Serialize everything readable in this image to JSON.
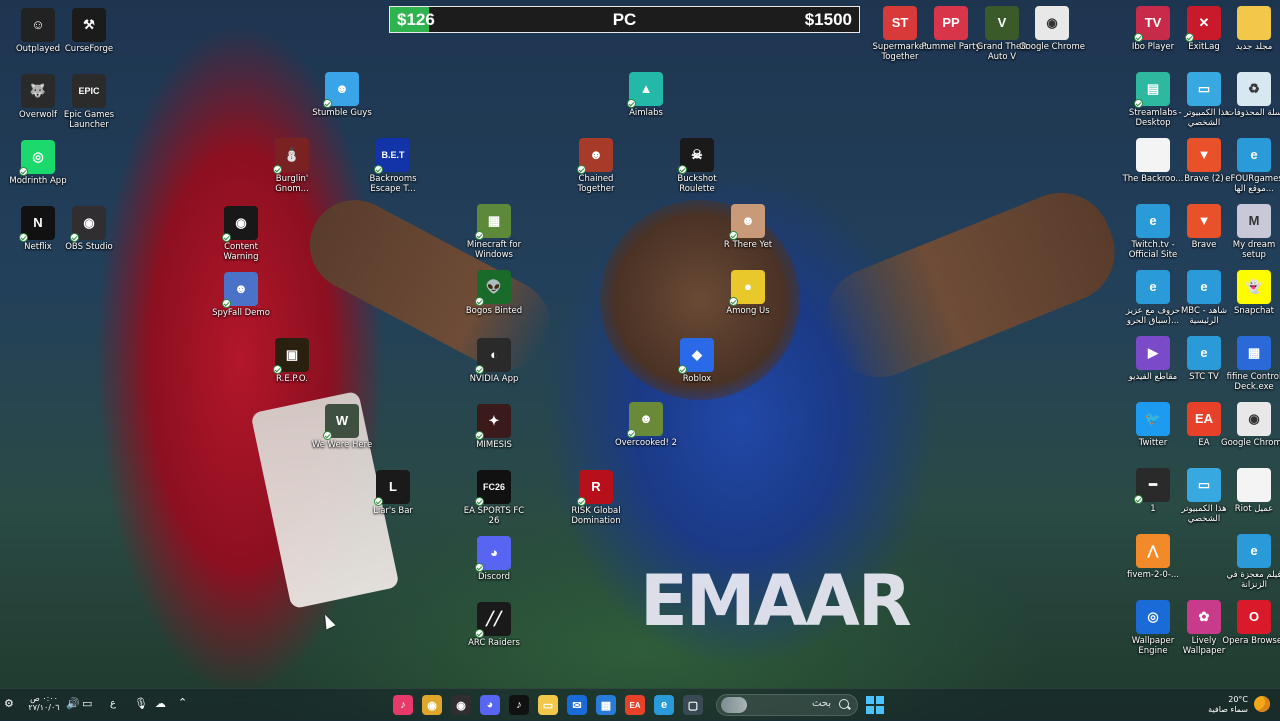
{
  "money_bar": {
    "current": "$126",
    "platform": "PC",
    "goal": "$1500",
    "progress": 0.084,
    "fill_color": "#2fb34f"
  },
  "wallpaper": {
    "jersey_text": "EMAAR"
  },
  "desktop_icons": [
    {
      "label": "Outplayed",
      "icon": "outplayed-icon",
      "color": "#222222",
      "glyph": "☺",
      "check": false
    },
    {
      "label": "CurseForge",
      "icon": "curseforge-icon",
      "color": "#1b1b1b",
      "glyph": "⚒",
      "check": false
    },
    {
      "label": "Overwolf",
      "icon": "overwolf-icon",
      "color": "#2a2a2a",
      "glyph": "🐺",
      "check": false
    },
    {
      "label": "Epic Games Launcher",
      "icon": "epic-games-icon",
      "color": "#2b2b2b",
      "glyph": "EPIC",
      "check": false
    },
    {
      "label": "Modrinth App",
      "icon": "modrinth-icon",
      "color": "#1bd96a",
      "glyph": "◎",
      "check": true
    },
    {
      "label": "Netflix",
      "icon": "netflix-icon",
      "color": "#111111",
      "glyph": "N",
      "check": true
    },
    {
      "label": "OBS Studio",
      "icon": "obs-icon",
      "color": "#302e31",
      "glyph": "◉",
      "check": true
    },
    {
      "label": "Stumble Guys",
      "icon": "stumble-guys-icon",
      "color": "#3aa4e8",
      "glyph": "☻",
      "check": true
    },
    {
      "label": "Burglin' Gnom...",
      "icon": "burglin-gnomes-icon",
      "color": "#7a2222",
      "glyph": "⛄",
      "check": true
    },
    {
      "label": "Backrooms Escape T...",
      "icon": "backrooms-icon",
      "color": "#1234a8",
      "glyph": "B.E.T",
      "check": true
    },
    {
      "label": "Content Warning",
      "icon": "content-warning-icon",
      "color": "#181818",
      "glyph": "◉",
      "check": true
    },
    {
      "label": "SpyFall Demo",
      "icon": "spyfall-icon",
      "color": "#4a72c8",
      "glyph": "☻",
      "check": true
    },
    {
      "label": "R.E.P.O.",
      "icon": "repo-icon",
      "color": "#2a2010",
      "glyph": "▣",
      "check": true
    },
    {
      "label": "We Were Here",
      "icon": "we-were-here-icon",
      "color": "#405040",
      "glyph": "W",
      "check": true
    },
    {
      "label": "Liar's Bar",
      "icon": "liars-bar-icon",
      "color": "#1a1a1a",
      "glyph": "L",
      "check": true
    },
    {
      "label": "Aimlabs",
      "icon": "aimlabs-icon",
      "color": "#23b8a8",
      "glyph": "▲",
      "check": true
    },
    {
      "label": "Minecraft for Windows",
      "icon": "minecraft-icon",
      "color": "#5d8a3a",
      "glyph": "▦",
      "check": true
    },
    {
      "label": "Bogos Binted",
      "icon": "bogos-binted-icon",
      "color": "#1a6a2a",
      "glyph": "👽",
      "check": true
    },
    {
      "label": "NVIDIA App",
      "icon": "nvidia-icon",
      "color": "#2a2a2a",
      "glyph": "◐",
      "check": true
    },
    {
      "label": "MIMESIS",
      "icon": "mimesis-icon",
      "color": "#3a1a1a",
      "glyph": "✦",
      "check": true
    },
    {
      "label": "EA SPORTS FC 26",
      "icon": "ea-fc-icon",
      "color": "#111111",
      "glyph": "FC26",
      "check": true
    },
    {
      "label": "Discord",
      "icon": "discord-icon",
      "color": "#5865f2",
      "glyph": "◕",
      "check": true
    },
    {
      "label": "ARC Raiders",
      "icon": "arc-raiders-icon",
      "color": "#1a1a1a",
      "glyph": "╱╱",
      "check": true
    },
    {
      "label": "Chained Together",
      "icon": "chained-together-icon",
      "color": "#a83a2a",
      "glyph": "☻",
      "check": true
    },
    {
      "label": "RISK Global Domination",
      "icon": "risk-icon",
      "color": "#b8101a",
      "glyph": "R",
      "check": true
    },
    {
      "label": "Overcooked! 2",
      "icon": "overcooked-icon",
      "color": "#6a8a3a",
      "glyph": "☻",
      "check": true
    },
    {
      "label": "Buckshot Roulette",
      "icon": "buckshot-icon",
      "color": "#1a1a1a",
      "glyph": "☠",
      "check": true
    },
    {
      "label": "R There Yet",
      "icon": "r-there-yet-icon",
      "color": "#c89a7a",
      "glyph": "☻",
      "check": true
    },
    {
      "label": "Among Us",
      "icon": "among-us-icon",
      "color": "#e8c82a",
      "glyph": "●",
      "check": true
    },
    {
      "label": "Roblox",
      "icon": "roblox-icon",
      "color": "#2a6ae8",
      "glyph": "◆",
      "check": true
    },
    {
      "label": "Supermarket Together",
      "icon": "supermarket-together-icon",
      "color": "#d83a3a",
      "glyph": "ST",
      "check": false
    },
    {
      "label": "Pummel Party",
      "icon": "pummel-party-icon",
      "color": "#d8344a",
      "glyph": "PP",
      "check": false
    },
    {
      "label": "Grand Theft Auto V",
      "icon": "gta-icon",
      "color": "#3a5a2a",
      "glyph": "V",
      "check": false
    },
    {
      "label": "Google Chrome",
      "icon": "chrome-icon",
      "color": "#e8e8e8",
      "glyph": "◉",
      "check": false
    },
    {
      "label": "Ibo Player",
      "icon": "ibo-player-icon",
      "color": "#c82a4a",
      "glyph": "TV",
      "check": true
    },
    {
      "label": "ExitLag",
      "icon": "exitlag-icon",
      "color": "#c81a2a",
      "glyph": "✕",
      "check": true
    },
    {
      "label": "مجلد جديد",
      "icon": "folder-icon",
      "color": "#f2c84a",
      "glyph": "",
      "check": false
    },
    {
      "label": "Streamlabs Desktop",
      "icon": "streamlabs-icon",
      "color": "#2fb8a0",
      "glyph": "▤",
      "check": true
    },
    {
      "label": "هذا الكمبيوتر - الشخصي",
      "icon": "this-pc-icon",
      "color": "#38a8e0",
      "glyph": "▭",
      "check": false
    },
    {
      "label": "سلة المحذوفات",
      "icon": "recycle-bin-icon",
      "color": "#d8e8f0",
      "glyph": "♻",
      "check": false
    },
    {
      "label": "The Backroo...",
      "icon": "file-icon",
      "color": "#f4f4f4",
      "glyph": "",
      "check": false
    },
    {
      "label": "Brave (2)",
      "icon": "brave-icon",
      "color": "#e8512a",
      "glyph": "▼",
      "check": false
    },
    {
      "label": "eFOURgames موقع الها...",
      "icon": "edge-icon",
      "color": "#2a9ad8",
      "glyph": "e",
      "check": false
    },
    {
      "label": "Twitch.tv - Official Site",
      "icon": "edge-icon",
      "color": "#2a9ad8",
      "glyph": "e",
      "check": false
    },
    {
      "label": "Brave",
      "icon": "brave-icon",
      "color": "#e8512a",
      "glyph": "▼",
      "check": false
    },
    {
      "label": "My dream setup",
      "icon": "image-file-icon",
      "color": "#c8c8d8",
      "glyph": "M",
      "check": false
    },
    {
      "label": "حروف مع عزيز (سباق الحرو...",
      "icon": "edge-icon",
      "color": "#2a9ad8",
      "glyph": "e",
      "check": false
    },
    {
      "label": "MBC - شاهد الرئيسية",
      "icon": "edge-icon",
      "color": "#2a9ad8",
      "glyph": "e",
      "check": false
    },
    {
      "label": "Snapchat",
      "icon": "snapchat-icon",
      "color": "#fffc00",
      "glyph": "👻",
      "check": false
    },
    {
      "label": "مقاطع الفيديو",
      "icon": "video-folder-icon",
      "color": "#7a4ac8",
      "glyph": "▶",
      "check": false
    },
    {
      "label": "STC TV",
      "icon": "edge-icon",
      "color": "#2a9ad8",
      "glyph": "e",
      "check": false
    },
    {
      "label": "fifine Control Deck.exe",
      "icon": "fifine-icon",
      "color": "#2a6ad8",
      "glyph": "▦",
      "check": false
    },
    {
      "label": "Twitter",
      "icon": "twitter-icon",
      "color": "#1d9bf0",
      "glyph": "🐦",
      "check": false
    },
    {
      "label": "EA",
      "icon": "ea-icon",
      "color": "#e8412a",
      "glyph": "EA",
      "check": false
    },
    {
      "label": "Google Chrome",
      "icon": "chrome-icon",
      "color": "#e8e8e8",
      "glyph": "◉",
      "check": false
    },
    {
      "label": "1",
      "icon": "shortcut-icon",
      "color": "#2a2a2a",
      "glyph": "━",
      "check": true
    },
    {
      "label": "هذا الكمبيوتر الشخصي",
      "icon": "this-pc-icon",
      "color": "#38a8e0",
      "glyph": "▭",
      "check": false
    },
    {
      "label": "Riot عميل",
      "icon": "file-icon",
      "color": "#f4f4f4",
      "glyph": "",
      "check": false
    },
    {
      "label": "fivem-2-0-...",
      "icon": "fivem-icon",
      "color": "#f28a2a",
      "glyph": "⋀",
      "check": false
    },
    {
      "label": "فيلم معجزة في الزنزانة",
      "icon": "edge-icon",
      "color": "#2a9ad8",
      "glyph": "e",
      "check": false
    },
    {
      "label": "Wallpaper Engine",
      "icon": "wallpaper-engine-icon",
      "color": "#1a6ad8",
      "glyph": "◎",
      "check": false
    },
    {
      "label": "Lively Wallpaper",
      "icon": "lively-wallpaper-icon",
      "color": "#c83a8a",
      "glyph": "✿",
      "check": false
    },
    {
      "label": "Opera Browser",
      "icon": "opera-icon",
      "color": "#d81a2a",
      "glyph": "O",
      "check": false
    }
  ],
  "taskbar": {
    "search_placeholder": "بحث",
    "pinned": [
      {
        "icon": "tiktok-icon",
        "color": "#e83a6a",
        "glyph": "♪"
      },
      {
        "icon": "chrome-icon",
        "color": "#e0a82a",
        "glyph": "◉"
      },
      {
        "icon": "obs-icon",
        "color": "#302e31",
        "glyph": "◉"
      },
      {
        "icon": "discord-icon",
        "color": "#5865f2",
        "glyph": "◕"
      },
      {
        "icon": "tiktok-icon",
        "color": "#111111",
        "glyph": "♪"
      },
      {
        "icon": "file-explorer-icon",
        "color": "#f2c84a",
        "glyph": "▭"
      },
      {
        "icon": "outlook-icon",
        "color": "#1a6ad8",
        "glyph": "✉"
      },
      {
        "icon": "store-icon",
        "color": "#2a7ad8",
        "glyph": "▦"
      },
      {
        "icon": "ea-icon",
        "color": "#e8412a",
        "glyph": "EA"
      },
      {
        "icon": "edge-icon",
        "color": "#2a9ad8",
        "glyph": "e"
      },
      {
        "icon": "app-icon",
        "color": "#3a4a55",
        "glyph": "▢"
      }
    ],
    "weather_temp": "20°C",
    "weather_desc": "سماء صافية",
    "clock_time": "٠:٠٠ ص",
    "clock_date": "٢٧/١٠/٠٦",
    "language": "ع"
  }
}
